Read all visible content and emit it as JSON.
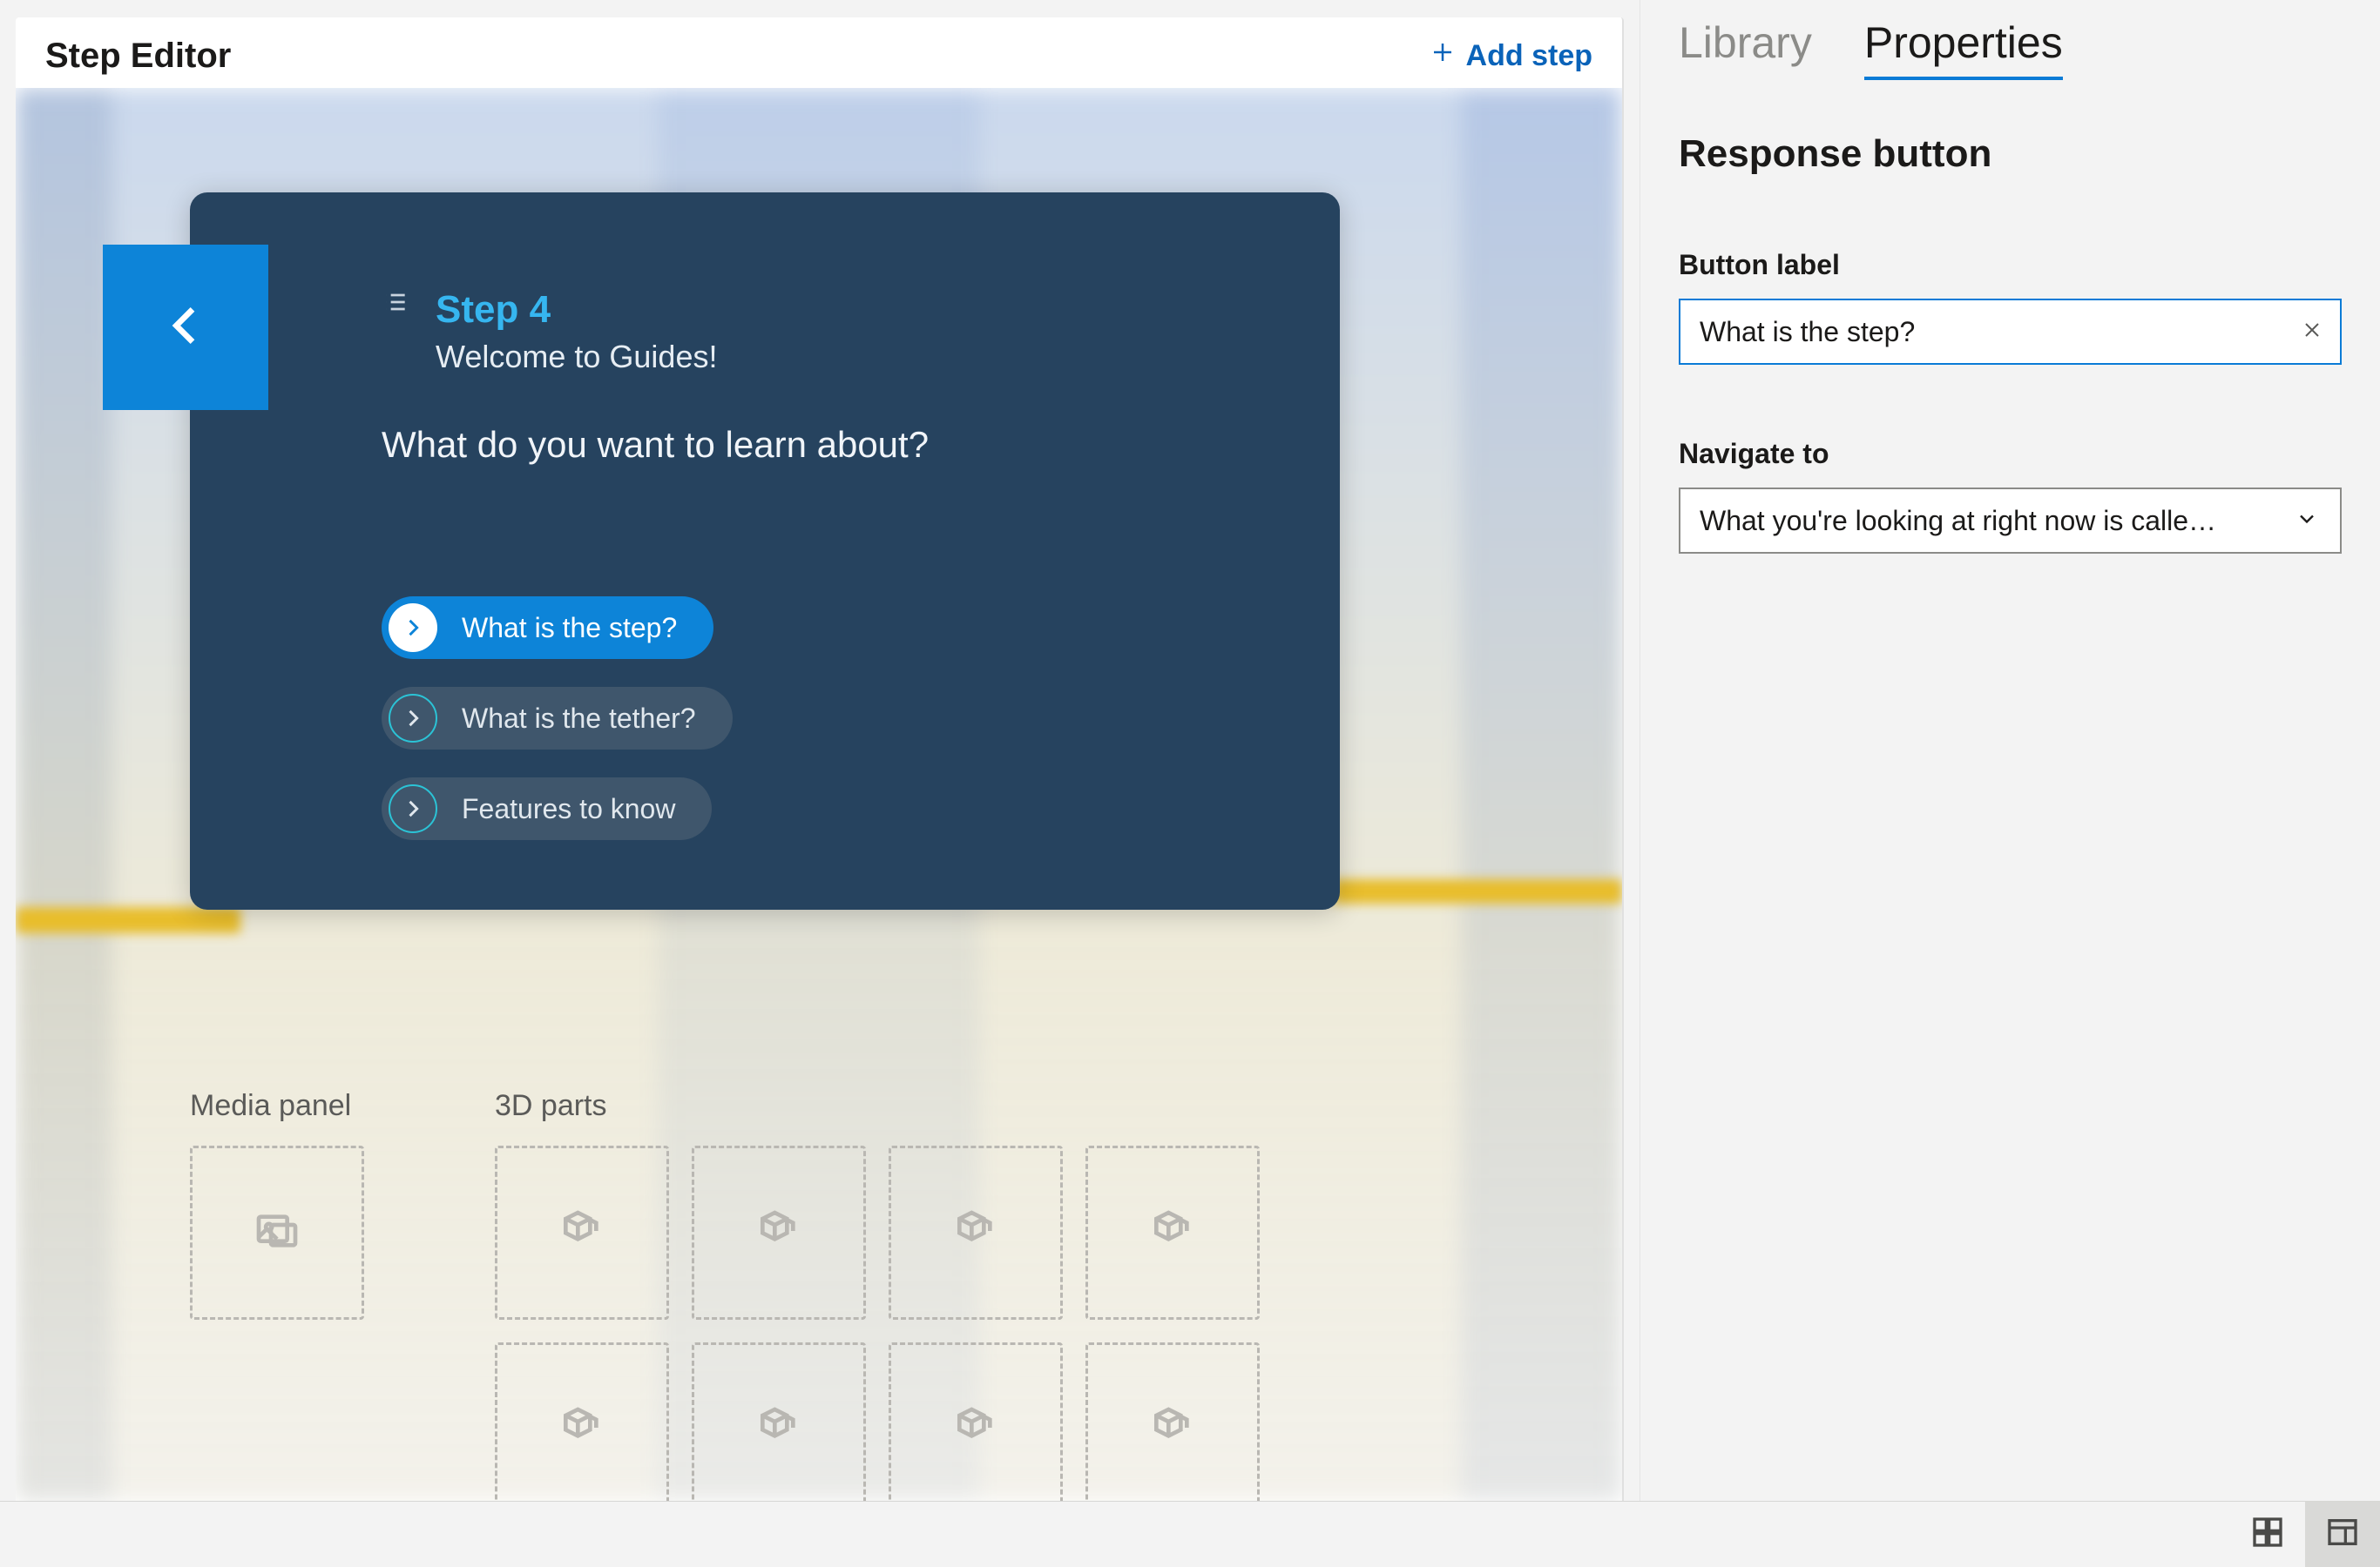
{
  "editor": {
    "title": "Step Editor",
    "add_step_label": "Add step"
  },
  "step_card": {
    "step_number": "Step 4",
    "subtitle": "Welcome to Guides!",
    "prompt": "What do you want to learn about?",
    "responses": [
      {
        "label": "What is the step?",
        "active": true
      },
      {
        "label": "What is the tether?",
        "active": false
      },
      {
        "label": "Features to know",
        "active": false
      }
    ]
  },
  "panels": {
    "media_label": "Media panel",
    "parts_label": "3D parts"
  },
  "sidebar": {
    "tabs": {
      "library": "Library",
      "properties": "Properties",
      "active": "properties"
    },
    "heading": "Response button",
    "button_label_field": "Button label",
    "button_label_value": "What is the step?",
    "navigate_field": "Navigate to",
    "navigate_value": "What you're looking at right now is calle…"
  },
  "icons": {
    "plus": "plus-icon",
    "arrow_left": "arrow-left-icon",
    "arrow_right": "arrow-right-icon",
    "list": "list-icon",
    "image": "image-icon",
    "cube": "cube-icon",
    "close": "close-icon",
    "chevron_down": "chevron-down-icon",
    "grid": "grid-view-icon",
    "detail": "detail-view-icon"
  }
}
